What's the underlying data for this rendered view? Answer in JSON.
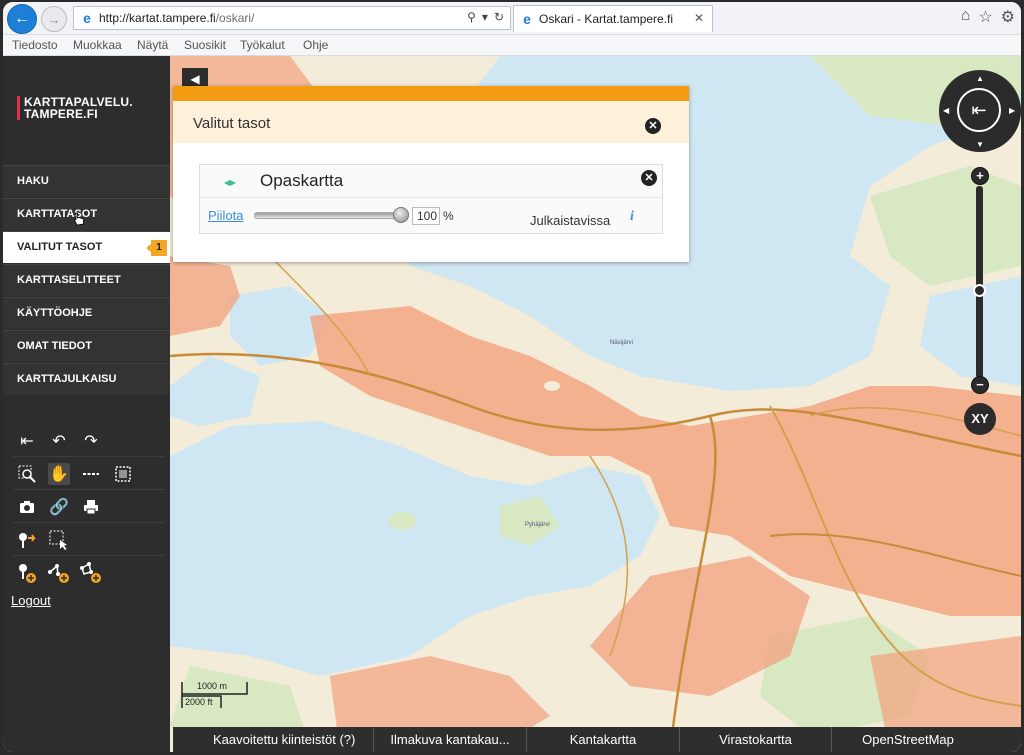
{
  "browser": {
    "url_host": "http://kartat.tampere.fi",
    "url_path": "/oskari/",
    "tab_title": "Oskari - Kartat.tampere.fi",
    "menu": [
      "Tiedosto",
      "Muokkaa",
      "Näytä",
      "Suosikit",
      "Työkalut",
      "Ohje"
    ]
  },
  "sidebar": {
    "logo_text": "KARTTAPALVELU.\nTAMPERE.FI",
    "items": [
      {
        "label": "HAKU"
      },
      {
        "label": "KARTTATASOT"
      },
      {
        "label": "VALITUT TASOT",
        "badge": "1",
        "active": true
      },
      {
        "label": "KARTTASELITTEET"
      },
      {
        "label": "KÄYTTÖOHJE"
      },
      {
        "label": "OMAT TIEDOT"
      },
      {
        "label": "KARTTAJULKAISU"
      }
    ],
    "logout": "Logout"
  },
  "panel": {
    "title": "Valitut tasot",
    "layer_name": "Opaskartta",
    "hide_link": "Piilota",
    "opacity": "100",
    "opacity_unit": "%",
    "status": "Julkaistavissa",
    "info": "i"
  },
  "map": {
    "xy_label": "XY",
    "scale_metric": "1000 m",
    "scale_imperial": "2000 ft",
    "lake_label_1": "Näsijärvi",
    "lake_label_2": "Pyhäjärvi"
  },
  "basemaps": [
    {
      "label": "Kaavoitettu kiinteistöt (?)"
    },
    {
      "label": "Ilmakuva kantakau..."
    },
    {
      "label": "Kantakartta"
    },
    {
      "label": "Virastokartta"
    },
    {
      "label": "OpenStreetMap"
    }
  ],
  "colors": {
    "accent": "#f39c12",
    "sidebar_bg": "#2d2d2d",
    "water": "#cfe6f3",
    "land": "#f3ecd9",
    "urban": "#f2a27d",
    "forest": "#d7e8c2"
  }
}
